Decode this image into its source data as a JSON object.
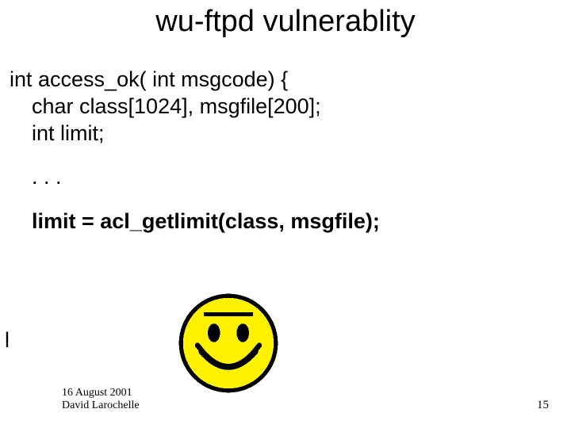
{
  "title": "wu-ftpd vulnerablity",
  "code": {
    "l1": "int access_ok( int msgcode) {",
    "l2": "char class[1024], msgfile[200];",
    "l3": "int limit;",
    "dots": ". . .",
    "assign": "limit = acl_getlimit(class, msgfile);"
  },
  "dangle": "l",
  "footer": {
    "date": "16 August 2001",
    "author": "David Larochelle",
    "page": "15"
  },
  "image": {
    "name": "smiley-face"
  },
  "colors": {
    "smiley_fill": "#fff200",
    "smiley_stroke": "#000000"
  }
}
